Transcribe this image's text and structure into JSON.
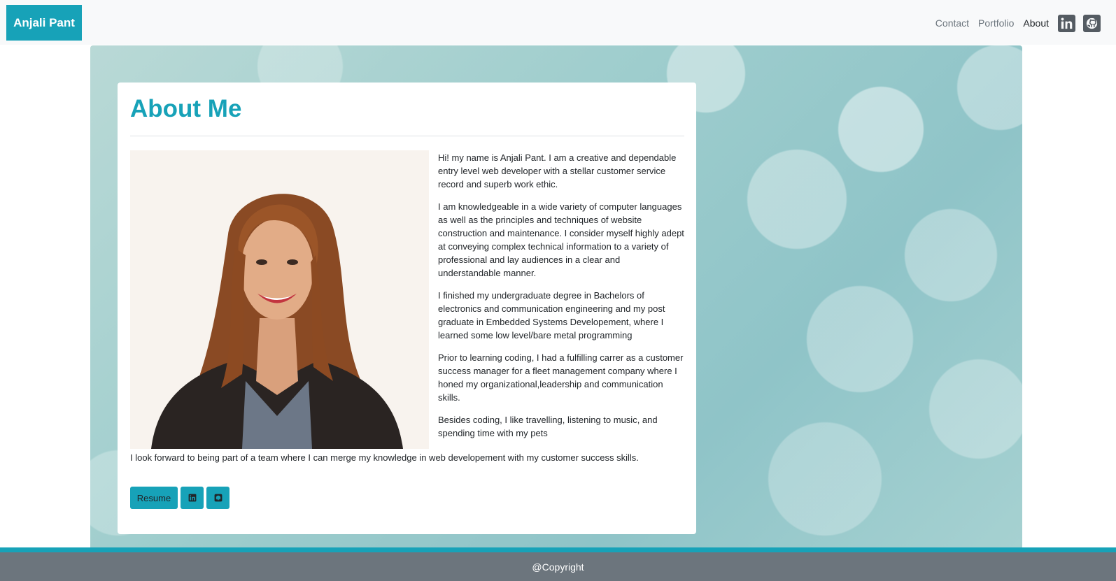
{
  "nav": {
    "brand": "Anjali Pant",
    "links": [
      {
        "label": "Contact",
        "active": false
      },
      {
        "label": "Portfolio",
        "active": false
      },
      {
        "label": "About",
        "active": true
      }
    ],
    "icons": [
      "linkedin-icon",
      "github-icon"
    ]
  },
  "about": {
    "title": "About Me",
    "paragraphs": [
      "Hi! my name is Anjali Pant. I am a creative and dependable entry level web developer with a stellar customer service record and superb work ethic.",
      "I am knowledgeable in a wide variety of computer languages as well as the principles and techniques of website construction and maintenance. I consider myself highly adept at conveying complex technical information to a variety of professional and lay audiences in a clear and understandable manner.",
      "I finished my undergraduate degree in Bachelors of electronics and communication engineering and my post graduate in Embedded Systems Developement, where I learned some low level/bare metal programming",
      "Prior to learning coding, I had a fulfilling carrer as a customer success manager for a fleet management company where I honed my organizational,leadership and communication skills.",
      "Besides coding, I like travelling, listening to music, and spending time with my pets"
    ],
    "closing": "I look forward to being part of a team where I can merge my knowledge in web developement with my customer success skills.",
    "buttons": {
      "resume": "Resume",
      "icons": [
        "linkedin-icon",
        "github-icon"
      ]
    }
  },
  "footer": {
    "text": "@Copyright"
  },
  "colors": {
    "accent": "#17a2b8",
    "footer_bg": "#6c757d",
    "navbar_bg": "#f8f9fa"
  }
}
